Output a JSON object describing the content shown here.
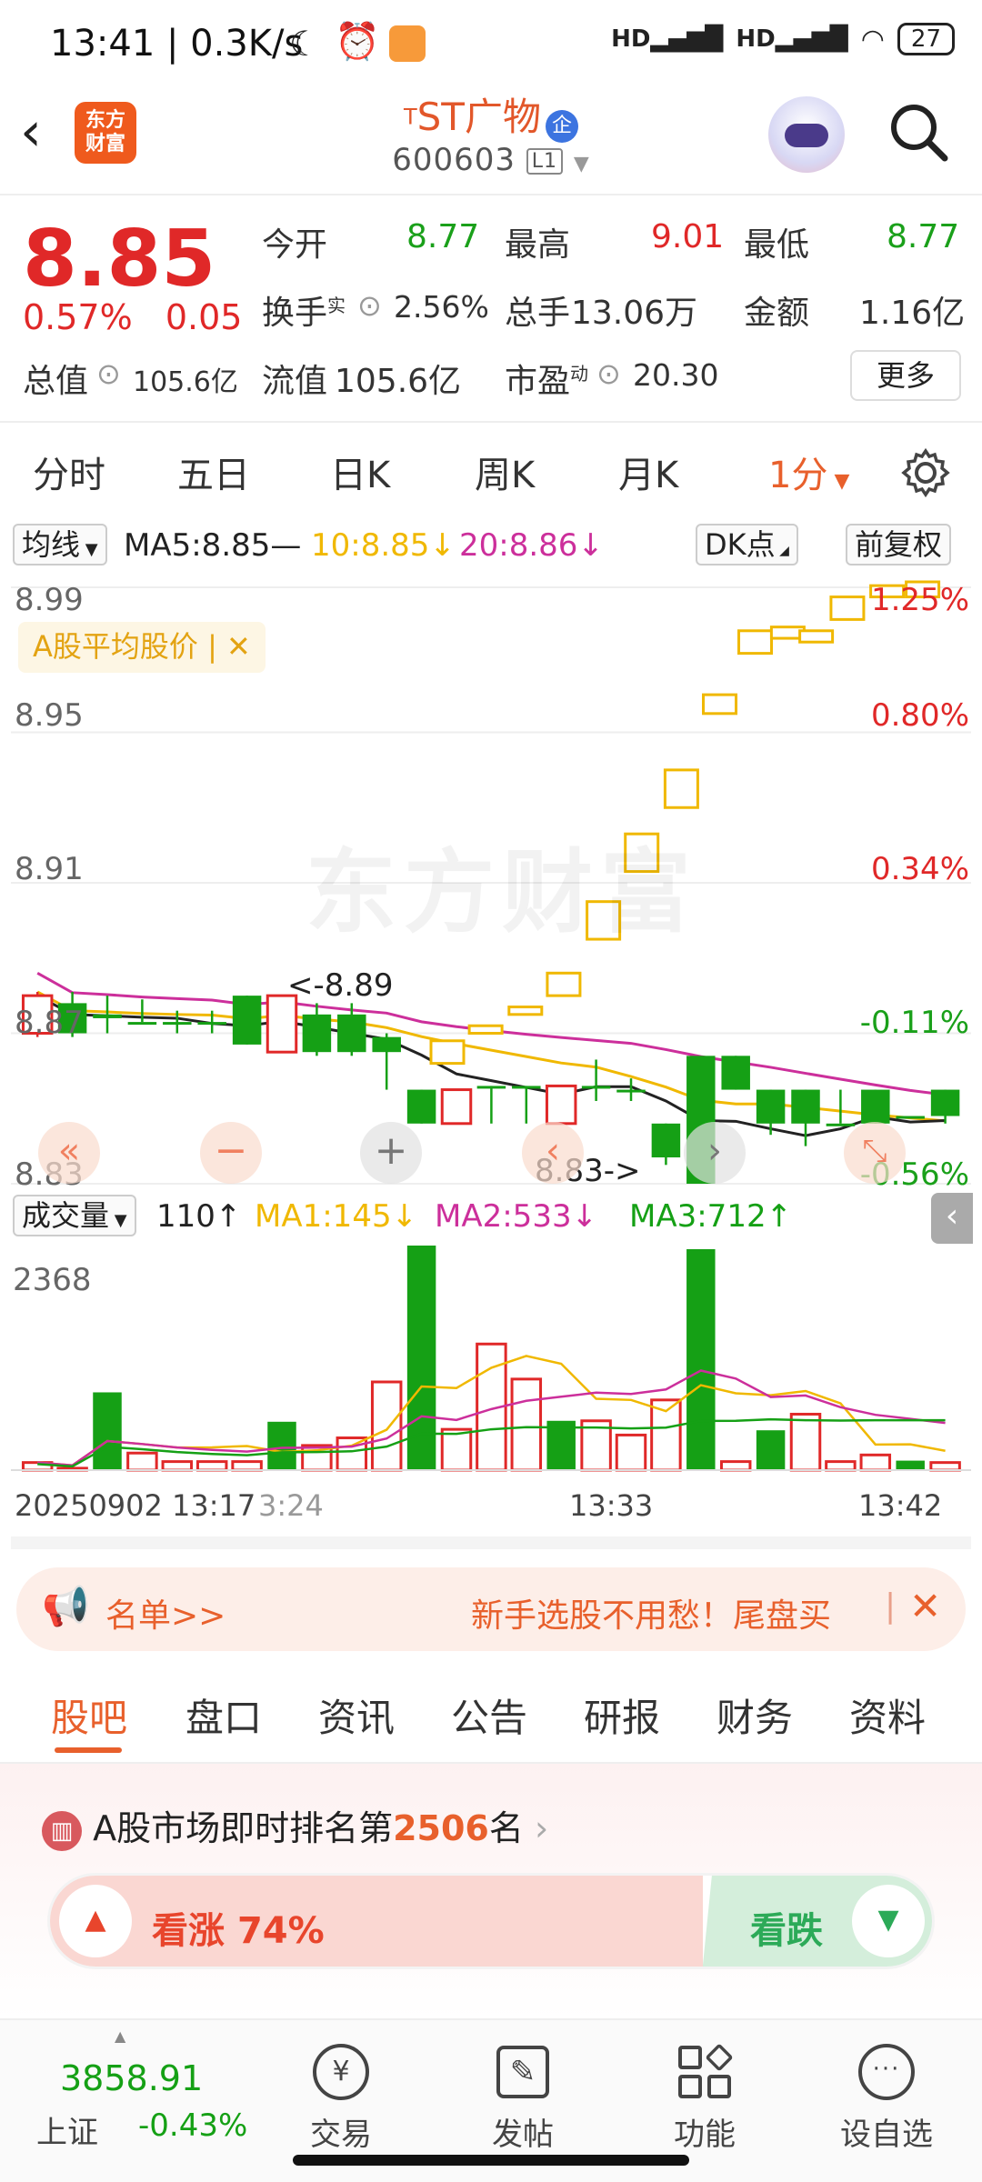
{
  "status_bar": {
    "time": "13:41 | 0.3K/s",
    "battery": "27"
  },
  "header": {
    "superscript": "T",
    "stock_name": "ST广物",
    "badge": "企",
    "code": "600603",
    "level": "L1",
    "logo_text": "东方财富"
  },
  "quote": {
    "price": "8.85",
    "change_pct": "0.57%",
    "change": "0.05",
    "open_label": "今开",
    "open": "8.77",
    "high_label": "最高",
    "high": "9.01",
    "low_label": "最低",
    "low": "8.77",
    "turnover_label": "换手",
    "turnover_sup": "实",
    "turnover": "2.56%",
    "volume_label": "总手",
    "volume": "13.06万",
    "amount_label": "金额",
    "amount": "1.16亿",
    "mcap_label": "总值",
    "mcap": "105.6亿",
    "float_label": "流值",
    "float": "105.6亿",
    "pe_label": "市盈",
    "pe_sup": "动",
    "pe": "20.30",
    "more": "更多"
  },
  "period_tabs": [
    "分时",
    "五日",
    "日K",
    "周K",
    "月K",
    "1分"
  ],
  "ma": {
    "label": "均线",
    "ma5": "MA5:8.85",
    "ma10": "10:8.85",
    "ma20": "20:8.86",
    "dk": "DK点",
    "fq": "前复权"
  },
  "chart": {
    "left_ticks": [
      "8.99",
      "8.95",
      "8.91",
      "8.87",
      "8.83"
    ],
    "right_ticks": [
      "1.25%",
      "0.80%",
      "0.34%",
      "-0.11%",
      "-0.56%"
    ],
    "legend_chip": "A股平均股价 |",
    "watermark": "东方财富",
    "high_marker": "<-8.89",
    "low_marker": "8.83->"
  },
  "chart_data": {
    "type": "candlestick",
    "ylim": [
      8.83,
      8.99
    ],
    "candles": [
      {
        "o": 8.87,
        "c": 8.88,
        "h": 8.881,
        "l": 8.869,
        "up": true
      },
      {
        "o": 8.878,
        "c": 8.87,
        "h": 8.881,
        "l": 8.869,
        "up": false
      },
      {
        "o": 8.875,
        "c": 8.874,
        "h": 8.88,
        "l": 8.87,
        "up": false
      },
      {
        "o": 8.873,
        "c": 8.873,
        "h": 8.879,
        "l": 8.873,
        "up": false
      },
      {
        "o": 8.873,
        "c": 8.873,
        "h": 8.876,
        "l": 8.87,
        "up": false
      },
      {
        "o": 8.873,
        "c": 8.873,
        "h": 8.876,
        "l": 8.87,
        "up": false
      },
      {
        "o": 8.88,
        "c": 8.867,
        "h": 8.88,
        "l": 8.867,
        "up": false
      },
      {
        "o": 8.865,
        "c": 8.88,
        "h": 8.88,
        "l": 8.865,
        "up": true
      },
      {
        "o": 8.875,
        "c": 8.865,
        "h": 8.878,
        "l": 8.864,
        "up": false
      },
      {
        "o": 8.875,
        "c": 8.865,
        "h": 8.878,
        "l": 8.864,
        "up": false
      },
      {
        "o": 8.869,
        "c": 8.865,
        "h": 8.87,
        "l": 8.855,
        "up": false
      },
      {
        "o": 8.855,
        "c": 8.846,
        "h": 8.855,
        "l": 8.846,
        "up": false
      },
      {
        "o": 8.846,
        "c": 8.855,
        "h": 8.855,
        "l": 8.846,
        "up": true
      },
      {
        "o": 8.856,
        "c": 8.856,
        "h": 8.856,
        "l": 8.846,
        "up": false
      },
      {
        "o": 8.856,
        "c": 8.856,
        "h": 8.856,
        "l": 8.846,
        "up": false
      },
      {
        "o": 8.846,
        "c": 8.856,
        "h": 8.856,
        "l": 8.846,
        "up": true
      },
      {
        "o": 8.856,
        "c": 8.856,
        "h": 8.863,
        "l": 8.852,
        "up": false
      },
      {
        "o": 8.855,
        "c": 8.855,
        "h": 8.858,
        "l": 8.852,
        "up": false
      },
      {
        "o": 8.846,
        "c": 8.837,
        "h": 8.846,
        "l": 8.835,
        "up": false
      },
      {
        "o": 8.864,
        "c": 8.83,
        "h": 8.864,
        "l": 8.83,
        "up": false
      },
      {
        "o": 8.864,
        "c": 8.855,
        "h": 8.864,
        "l": 8.855,
        "up": false
      },
      {
        "o": 8.855,
        "c": 8.846,
        "h": 8.855,
        "l": 8.843,
        "up": false
      },
      {
        "o": 8.855,
        "c": 8.846,
        "h": 8.855,
        "l": 8.84,
        "up": false
      },
      {
        "o": 8.846,
        "c": 8.846,
        "h": 8.855,
        "l": 8.846,
        "up": false
      },
      {
        "o": 8.855,
        "c": 8.846,
        "h": 8.855,
        "l": 8.846,
        "up": false
      },
      {
        "o": 8.848,
        "c": 8.848,
        "h": 8.848,
        "l": 8.848,
        "up": false
      },
      {
        "o": 8.855,
        "c": 8.848,
        "h": 8.855,
        "l": 8.846,
        "up": false
      }
    ],
    "volumes": [
      80,
      20,
      820,
      180,
      90,
      90,
      90,
      510,
      260,
      340,
      930,
      2368,
      430,
      1330,
      960,
      520,
      520,
      370,
      740,
      2330,
      90,
      420,
      590,
      90,
      160,
      100,
      80
    ],
    "vol_ylim": [
      0,
      2368
    ]
  },
  "volume": {
    "label": "成交量",
    "last": "110",
    "ma1": "MA1:145",
    "ma2": "MA2:533",
    "ma3": "MA3:712",
    "top_tick": "2368"
  },
  "time_axis": [
    "20250902 13:17",
    "3:24",
    "13:33",
    "13:42"
  ],
  "banner": {
    "left": "名单>>",
    "right": "新手选股不用愁！尾盘买"
  },
  "func_tabs": [
    "股吧",
    "盘口",
    "资讯",
    "公告",
    "研报",
    "财务",
    "资料"
  ],
  "rank": {
    "prefix": "A股市场即时排名第",
    "number": "2506",
    "suffix": "名"
  },
  "vote": {
    "up_label": "看涨",
    "up_pct": "74%",
    "down_label": "看跌",
    "up_ratio": 0.74
  },
  "index": {
    "value": "3858.91",
    "name": "上证",
    "change": "-0.43%"
  },
  "bottom_nav": [
    "交易",
    "发帖",
    "功能",
    "设自选"
  ],
  "colors": {
    "up": "#e02828",
    "down": "#15a015",
    "ma5": "#222222",
    "ma10": "#f0b800",
    "ma20": "#cc2f9b",
    "accent": "#e8602c"
  }
}
